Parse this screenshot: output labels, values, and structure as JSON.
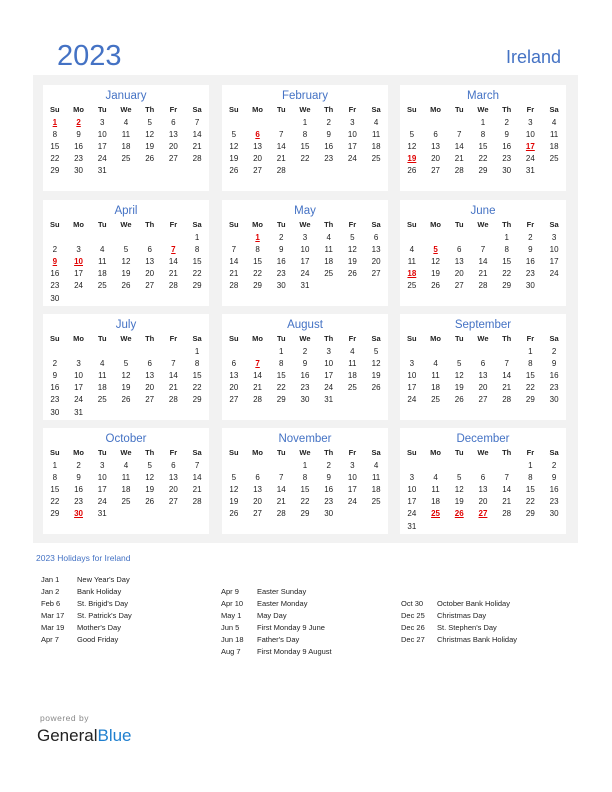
{
  "header": {
    "year": "2023",
    "country": "Ireland"
  },
  "weekdays": [
    "Su",
    "Mo",
    "Tu",
    "We",
    "Th",
    "Fr",
    "Sa"
  ],
  "months": [
    {
      "name": "January",
      "start": 0,
      "days": 31,
      "holidays": [
        1,
        2
      ]
    },
    {
      "name": "February",
      "start": 3,
      "days": 28,
      "holidays": [
        6
      ]
    },
    {
      "name": "March",
      "start": 3,
      "days": 31,
      "holidays": [
        17,
        19
      ]
    },
    {
      "name": "April",
      "start": 6,
      "days": 30,
      "holidays": [
        7,
        9,
        10
      ]
    },
    {
      "name": "May",
      "start": 1,
      "days": 31,
      "holidays": [
        1
      ]
    },
    {
      "name": "June",
      "start": 4,
      "days": 30,
      "holidays": [
        5,
        18
      ]
    },
    {
      "name": "July",
      "start": 6,
      "days": 31,
      "holidays": []
    },
    {
      "name": "August",
      "start": 2,
      "days": 31,
      "holidays": [
        7
      ]
    },
    {
      "name": "September",
      "start": 5,
      "days": 30,
      "holidays": []
    },
    {
      "name": "October",
      "start": 0,
      "days": 31,
      "holidays": [
        30
      ]
    },
    {
      "name": "November",
      "start": 3,
      "days": 30,
      "holidays": []
    },
    {
      "name": "December",
      "start": 5,
      "days": 31,
      "holidays": [
        25,
        26,
        27
      ]
    }
  ],
  "holidays_title": "2023 Holidays for Ireland",
  "holiday_columns": [
    [
      {
        "date": "Jan 1",
        "name": "New Year's Day"
      },
      {
        "date": "Jan 2",
        "name": "Bank Holiday"
      },
      {
        "date": "Feb 6",
        "name": "St. Brigid's Day"
      },
      {
        "date": "Mar 17",
        "name": "St. Patrick's Day"
      },
      {
        "date": "Mar 19",
        "name": "Mother's Day"
      },
      {
        "date": "Apr 7",
        "name": "Good Friday"
      }
    ],
    [
      {
        "date": "Apr 9",
        "name": "Easter Sunday"
      },
      {
        "date": "Apr 10",
        "name": "Easter Monday"
      },
      {
        "date": "May 1",
        "name": "May Day"
      },
      {
        "date": "Jun 5",
        "name": "First Monday 9 June"
      },
      {
        "date": "Jun 18",
        "name": "Father's Day"
      },
      {
        "date": "Aug 7",
        "name": "First Monday 9 August"
      }
    ],
    [
      {
        "date": "Oct 30",
        "name": "October Bank Holiday"
      },
      {
        "date": "Dec 25",
        "name": "Christmas Day"
      },
      {
        "date": "Dec 26",
        "name": "St. Stephen's Day"
      },
      {
        "date": "Dec 27",
        "name": "Christmas Bank Holiday"
      }
    ]
  ],
  "footer": {
    "powered": "powered by",
    "brand_a": "General",
    "brand_b": "Blue"
  }
}
